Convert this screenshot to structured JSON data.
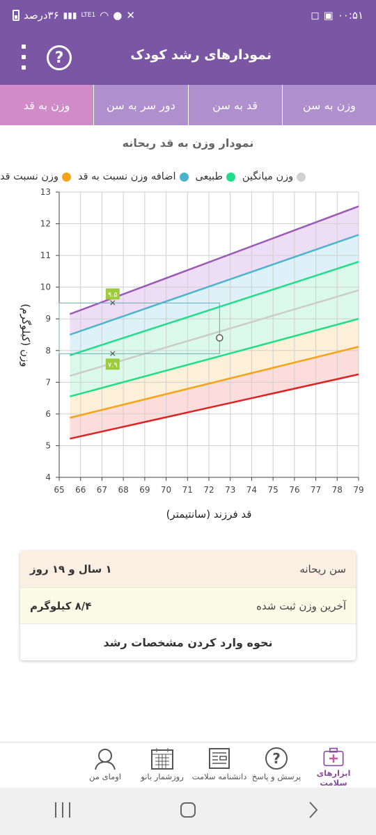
{
  "status": {
    "time": "۰۰:۵۱",
    "battery": "۳۶درصد",
    "network": "LTE1"
  },
  "appbar": {
    "title": "نمودارهای رشد کودک",
    "help": "?"
  },
  "tabs": [
    {
      "label": "وزن به قد",
      "active": true
    },
    {
      "label": "دور سر به سن",
      "active": false
    },
    {
      "label": "قد به سن",
      "active": false
    },
    {
      "label": "وزن به سن",
      "active": false
    }
  ],
  "chart_title": "نمودار وزن به قد ریحانه",
  "legend": [
    {
      "label": "وزن میانگین",
      "color": "#d0d0d0"
    },
    {
      "label": "طبیعی",
      "color": "#22dd88"
    },
    {
      "label": "اضافه وزن نسبت به قد",
      "color": "#4bb4cc"
    },
    {
      "label": "وزن نسبت قد",
      "color": "#f4a417"
    }
  ],
  "chart_data": {
    "type": "line",
    "xlabel": "قد فرزند (سانتیمتر)",
    "ylabel": "وزن (کیلوگرم)",
    "xlim": [
      65,
      79
    ],
    "ylim": [
      4,
      13
    ],
    "x_ticks": [
      "65",
      "66",
      "67",
      "68",
      "69",
      "70",
      "71",
      "72",
      "73",
      "74",
      "75",
      "76",
      "77",
      "78",
      "79"
    ],
    "y_ticks": [
      "4",
      "5",
      "6",
      "7",
      "8",
      "9",
      "10",
      "11",
      "12",
      "13"
    ],
    "series": [
      {
        "color": "#9b59b6",
        "x": [
          65.5,
          79
        ],
        "y": [
          9.15,
          12.55
        ]
      },
      {
        "color": "#4bb4cc",
        "x": [
          65.5,
          79
        ],
        "y": [
          8.5,
          11.65
        ]
      },
      {
        "color": "#22dd88",
        "x": [
          65.5,
          79
        ],
        "y": [
          7.85,
          10.8
        ]
      },
      {
        "color": "#cccccc",
        "x": [
          65.5,
          79
        ],
        "y": [
          7.2,
          9.9
        ]
      },
      {
        "color": "#22dd88",
        "x": [
          65.5,
          79
        ],
        "y": [
          6.55,
          9.0
        ]
      },
      {
        "color": "#f4a417",
        "x": [
          65.5,
          79
        ],
        "y": [
          5.88,
          8.12
        ]
      },
      {
        "color": "#dd2222",
        "x": [
          65.5,
          79
        ],
        "y": [
          5.22,
          7.25
        ]
      }
    ],
    "bands": [
      {
        "color": "#e9d4f2",
        "upper": 0,
        "lower": 1
      },
      {
        "color": "#d3eef6",
        "upper": 1,
        "lower": 2
      },
      {
        "color": "#d2f7e6",
        "upper": 2,
        "lower": 4
      },
      {
        "color": "#fdecd0",
        "upper": 4,
        "lower": 5
      },
      {
        "color": "#fcd3d3",
        "upper": 5,
        "lower": 6
      }
    ],
    "reference_box": {
      "x0": 65,
      "x1": 72.5,
      "y_high": 9.5,
      "y_low": 7.9
    },
    "point": {
      "x": 72.5,
      "y": 8.4
    },
    "markers": [
      {
        "x": 67.5,
        "y": 9.5,
        "label": "۹.۵"
      },
      {
        "x": 67.5,
        "y": 7.9,
        "label": "۷.۹"
      }
    ]
  },
  "info": {
    "age_label": "سن ریحانه",
    "age_value": "۱ سال و ۱۹ روز",
    "weight_label": "آخرین وزن ثبت شده",
    "weight_value": "۸/۴ کیلوگرم",
    "howto": "نحوه وارد کردن مشخصات رشد"
  },
  "bottom_nav": [
    {
      "label": "ابزارهای سلامت",
      "icon": "medkit-icon",
      "active": true
    },
    {
      "label": "پرسش و پاسخ",
      "icon": "question-icon",
      "active": false
    },
    {
      "label": "دانشنامه سلامت",
      "icon": "news-icon",
      "active": false
    },
    {
      "label": "روزشمار بانو",
      "icon": "calendar-icon",
      "active": false
    },
    {
      "label": "اومای من",
      "icon": "profile-icon",
      "active": false
    }
  ]
}
